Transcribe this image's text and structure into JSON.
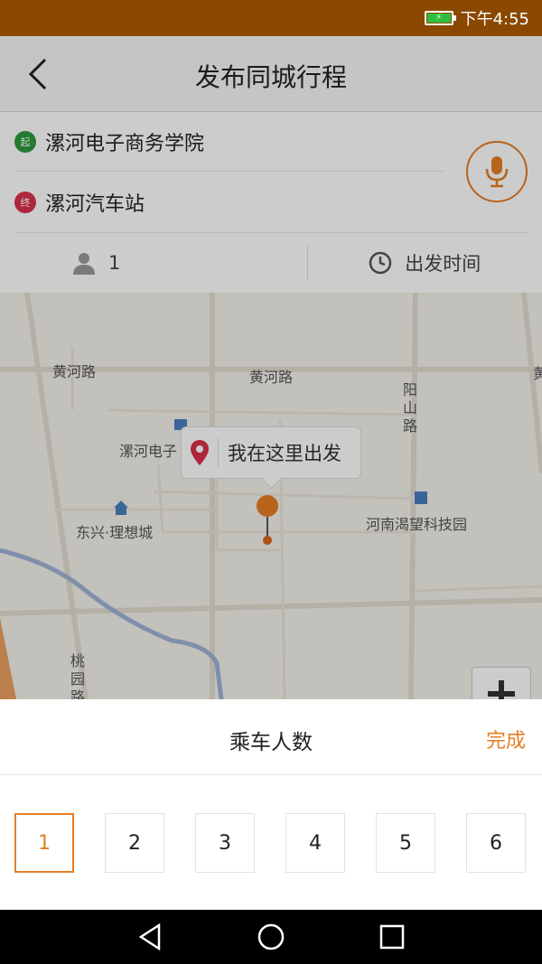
{
  "status_bar": {
    "time": "下午4:55"
  },
  "header": {
    "title": "发布同城行程"
  },
  "route": {
    "start_badge": "起",
    "start": "漯河电子商务学院",
    "end_badge": "终",
    "end": "漯河汽车站"
  },
  "options": {
    "passengers": "1",
    "departure_time": "出发时间"
  },
  "map": {
    "callout": "我在这里出发",
    "labels": {
      "road_1": "黄河路",
      "road_2": "黄河路",
      "road_3": "黄",
      "road_4": "阳山路",
      "poi_1": "漯河电子",
      "poi_2": "东兴·理想城",
      "poi_3": "河南渴望科技园",
      "road_5": "桃园路"
    }
  },
  "sheet": {
    "title": "乘车人数",
    "done": "完成",
    "counts": [
      "1",
      "2",
      "3",
      "4",
      "5",
      "6"
    ],
    "selected": "1"
  },
  "colors": {
    "accent": "#e57e25",
    "status_bar": "#8a4800",
    "start": "#2c9a3c",
    "end": "#d9304a"
  }
}
